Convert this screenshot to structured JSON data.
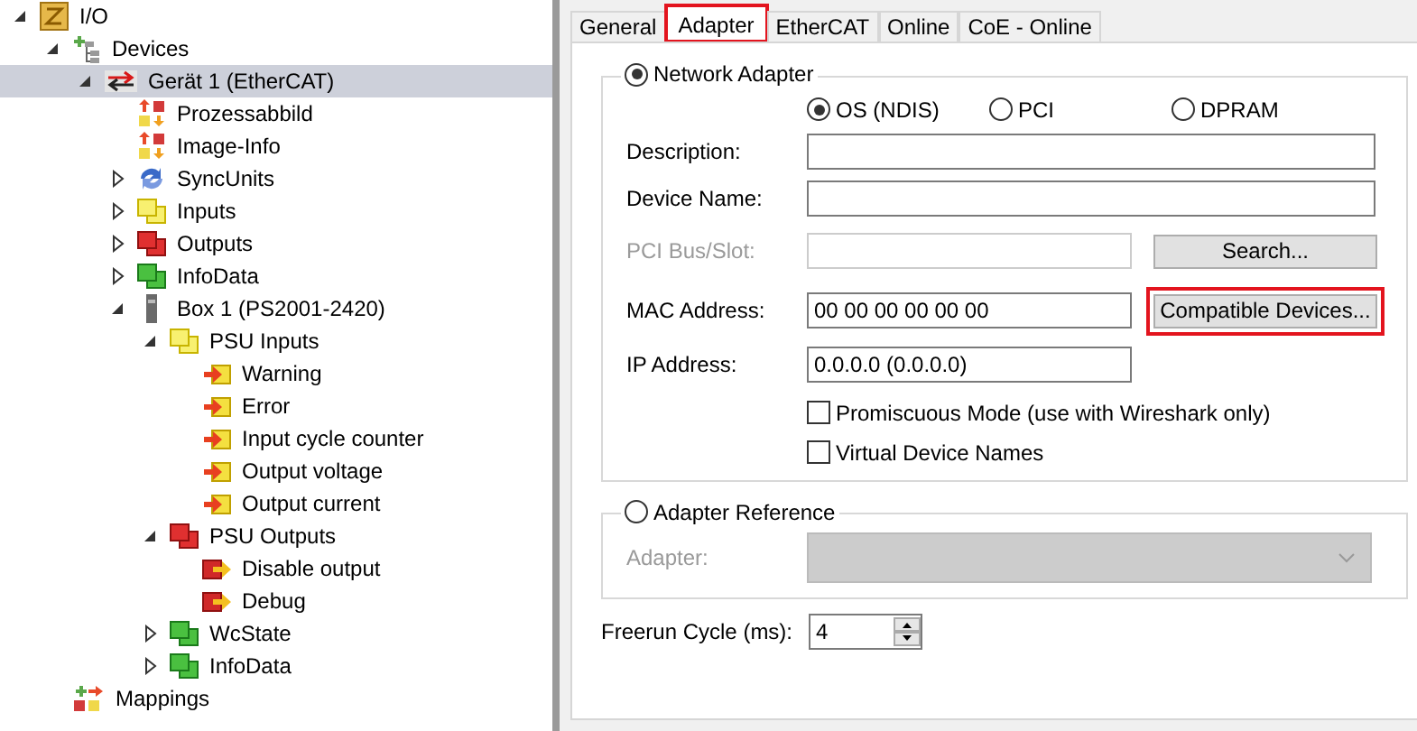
{
  "tree": [
    {
      "label": "I/O",
      "kind": "io",
      "expanded": true,
      "selected": false,
      "children": [
        {
          "label": "Devices",
          "kind": "devices",
          "expanded": true,
          "selected": false,
          "children": [
            {
              "label": "Gerät 1 (EtherCAT)",
              "kind": "ethercat",
              "expanded": true,
              "selected": true,
              "children": [
                {
                  "label": "Prozessabbild",
                  "kind": "image",
                  "selected": false
                },
                {
                  "label": "Image-Info",
                  "kind": "image",
                  "selected": false
                },
                {
                  "label": "SyncUnits",
                  "kind": "sync",
                  "expanded": false,
                  "selected": false
                },
                {
                  "label": "Inputs",
                  "kind": "inputs",
                  "expanded": false,
                  "selected": false
                },
                {
                  "label": "Outputs",
                  "kind": "outputs",
                  "expanded": false,
                  "selected": false
                },
                {
                  "label": "InfoData",
                  "kind": "infodata",
                  "expanded": false,
                  "selected": false
                },
                {
                  "label": "Box 1 (PS2001-2420)",
                  "kind": "box",
                  "expanded": true,
                  "selected": false,
                  "children": [
                    {
                      "label": "PSU Inputs",
                      "kind": "inputs",
                      "expanded": true,
                      "selected": false,
                      "children": [
                        {
                          "label": "Warning",
                          "kind": "input-var",
                          "selected": false
                        },
                        {
                          "label": "Error",
                          "kind": "input-var",
                          "selected": false
                        },
                        {
                          "label": "Input cycle counter",
                          "kind": "input-var",
                          "selected": false
                        },
                        {
                          "label": "Output voltage",
                          "kind": "input-var",
                          "selected": false
                        },
                        {
                          "label": "Output current",
                          "kind": "input-var",
                          "selected": false
                        }
                      ]
                    },
                    {
                      "label": "PSU Outputs",
                      "kind": "outputs",
                      "expanded": true,
                      "selected": false,
                      "children": [
                        {
                          "label": "Disable output",
                          "kind": "output-var",
                          "selected": false
                        },
                        {
                          "label": "Debug",
                          "kind": "output-var",
                          "selected": false
                        }
                      ]
                    },
                    {
                      "label": "WcState",
                      "kind": "infodata",
                      "expanded": false,
                      "selected": false
                    },
                    {
                      "label": "InfoData",
                      "kind": "infodata",
                      "expanded": false,
                      "selected": false
                    }
                  ]
                }
              ]
            }
          ]
        },
        {
          "label": "Mappings",
          "kind": "mappings",
          "selected": false
        }
      ]
    }
  ],
  "tabs": [
    {
      "label": "General",
      "selected": false,
      "highlighted": false
    },
    {
      "label": "Adapter",
      "selected": true,
      "highlighted": true
    },
    {
      "label": "EtherCAT",
      "selected": false,
      "highlighted": false
    },
    {
      "label": "Online",
      "selected": false,
      "highlighted": false
    },
    {
      "label": "CoE - Online",
      "selected": false,
      "highlighted": false
    }
  ],
  "network_adapter": {
    "label": "Network Adapter",
    "selected": true,
    "modes": [
      {
        "label": "OS (NDIS)",
        "selected": true
      },
      {
        "label": "PCI",
        "selected": false
      },
      {
        "label": "DPRAM",
        "selected": false
      }
    ],
    "fields": [
      {
        "label": "Description:",
        "kind": "wide",
        "disabled": false
      },
      {
        "label": "Device Name:",
        "kind": "wide",
        "disabled": false
      },
      {
        "label": "PCI Bus/Slot:",
        "kind": "narrow",
        "disabled": true,
        "button": {
          "label": "Search...",
          "highlighted": false
        }
      },
      {
        "label": "MAC Address:",
        "kind": "narrow",
        "disabled": false,
        "value": "00 00 00 00 00 00",
        "button": {
          "label": "Compatible Devices...",
          "highlighted": true
        }
      },
      {
        "label": "IP Address:",
        "kind": "narrow",
        "disabled": false,
        "value": "0.0.0.0 (0.0.0.0)"
      }
    ],
    "checkboxes": [
      {
        "label": "Promiscuous Mode (use with Wireshark only)",
        "checked": false
      },
      {
        "label": "Virtual Device Names",
        "checked": false
      }
    ]
  },
  "adapter_reference": {
    "label": "Adapter Reference",
    "selected": false,
    "adapter": {
      "label": "Adapter:",
      "disabled": true
    }
  },
  "freerun_cycle": {
    "label": "Freerun Cycle (ms):",
    "value": "4"
  }
}
